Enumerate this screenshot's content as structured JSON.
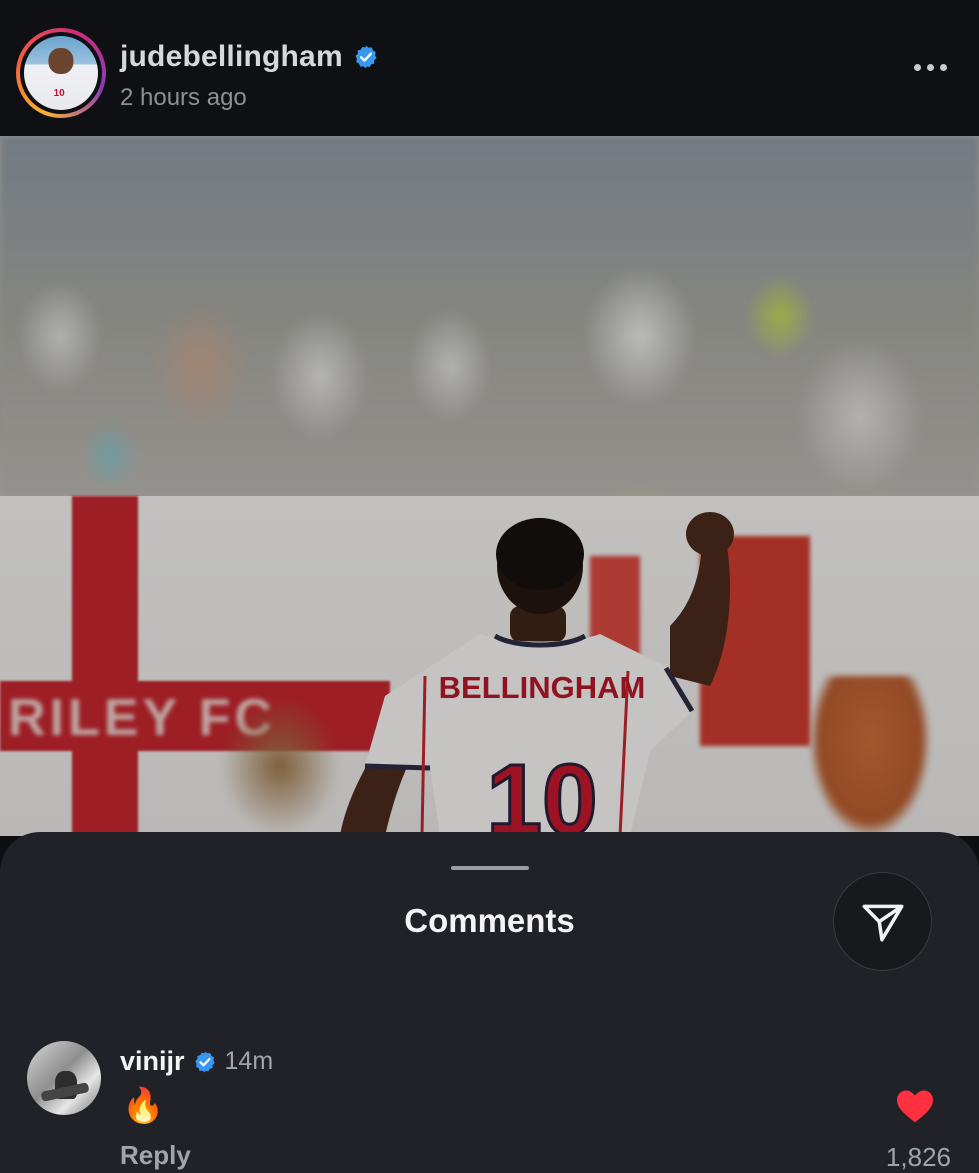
{
  "post": {
    "username": "judebellingham",
    "timestamp": "2 hours ago",
    "verified": true,
    "photo": {
      "shirt_name": "BELLINGHAM",
      "shirt_number": "10",
      "banner_text": "RILEY FC"
    }
  },
  "comments_sheet": {
    "title": "Comments",
    "share_icon": "send-icon"
  },
  "comments": [
    {
      "username": "vinijr",
      "verified": true,
      "time": "14m",
      "text": "🔥",
      "reply_label": "Reply",
      "liked": true,
      "like_count": "1,826"
    }
  ],
  "colors": {
    "verified_blue": "#3897f0",
    "like_red": "#ff3040",
    "sheet_bg": "#212227"
  }
}
